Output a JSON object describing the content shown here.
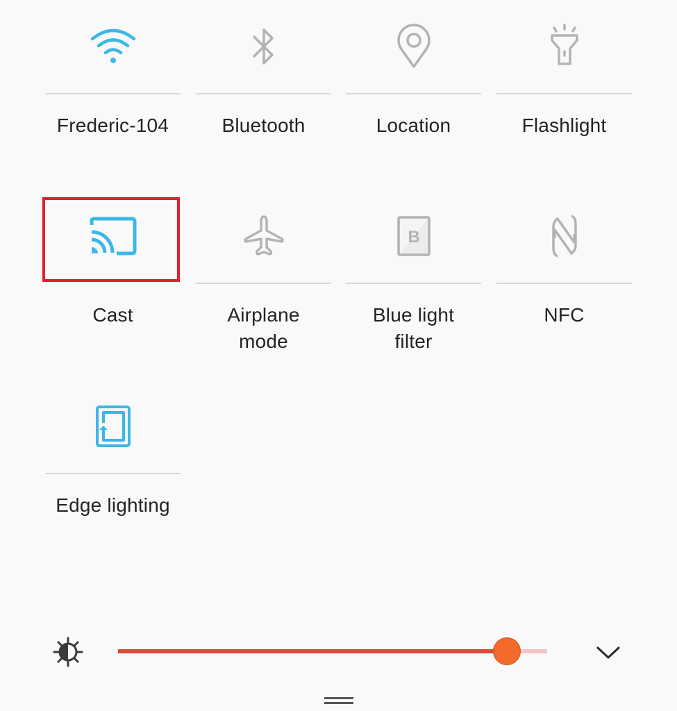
{
  "tiles": [
    {
      "id": "wifi",
      "label_line1": "Frederic-104",
      "label_line2": "",
      "icon": "wifi-icon",
      "active": true
    },
    {
      "id": "bluetooth",
      "label_line1": "Bluetooth",
      "label_line2": "",
      "icon": "bluetooth-icon",
      "active": false
    },
    {
      "id": "location",
      "label_line1": "Location",
      "label_line2": "",
      "icon": "location-pin-icon",
      "active": false
    },
    {
      "id": "flashlight",
      "label_line1": "Flashlight",
      "label_line2": "",
      "icon": "flashlight-icon",
      "active": false
    },
    {
      "id": "cast",
      "label_line1": "Cast",
      "label_line2": "",
      "icon": "cast-icon",
      "active": true,
      "highlighted": true
    },
    {
      "id": "airplane",
      "label_line1": "Airplane",
      "label_line2": "mode",
      "icon": "airplane-icon",
      "active": false
    },
    {
      "id": "blue-light",
      "label_line1": "Blue light",
      "label_line2": "filter",
      "icon": "blue-light-filter-icon",
      "active": false
    },
    {
      "id": "nfc",
      "label_line1": "NFC",
      "label_line2": "",
      "icon": "nfc-icon",
      "active": false
    },
    {
      "id": "edge-lighting",
      "label_line1": "Edge lighting",
      "label_line2": "",
      "icon": "edge-lighting-icon",
      "active": true
    }
  ],
  "blue_light_glyph": "B",
  "brightness": {
    "value_fraction": 0.906,
    "icon": "brightness-icon"
  },
  "colors": {
    "active_icon": "#3bb8e6",
    "inactive_icon": "#b3b3b3",
    "highlight_border": "#e31d2b",
    "slider_fill": "#d94b3a",
    "slider_track": "#f3c4c4",
    "slider_thumb": "#f36a2b"
  }
}
